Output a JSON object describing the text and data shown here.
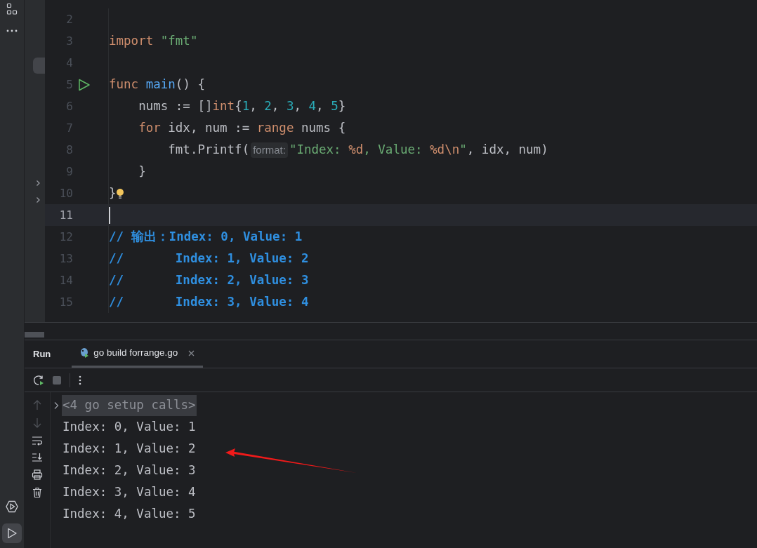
{
  "tool_windows": [
    {
      "kind": "services",
      "selected": false
    },
    {
      "kind": "run",
      "selected": true
    }
  ],
  "editor": {
    "lines": [
      {
        "number": "2",
        "current": false,
        "run_marker": false,
        "bulb": false,
        "caret": false
      },
      {
        "number": "3",
        "current": false,
        "run_marker": false,
        "bulb": false,
        "caret": false,
        "tokens": [
          {
            "text": "import ",
            "kind": "keyword"
          },
          {
            "text": "\"fmt\"",
            "kind": "string"
          }
        ]
      },
      {
        "number": "4",
        "current": false,
        "run_marker": false,
        "bulb": false,
        "caret": false
      },
      {
        "number": "5",
        "current": false,
        "run_marker": true,
        "bulb": false,
        "caret": false,
        "tokens": [
          {
            "text": "func ",
            "kind": "keyword"
          },
          {
            "text": "main",
            "kind": "func"
          },
          {
            "text": "() {",
            "kind": "plain"
          }
        ]
      },
      {
        "number": "6",
        "current": false,
        "run_marker": false,
        "bulb": false,
        "caret": false,
        "tokens": [
          {
            "text": "    nums := []",
            "kind": "plain"
          },
          {
            "text": "int",
            "kind": "keyword"
          },
          {
            "text": "{",
            "kind": "plain"
          },
          {
            "text": "1",
            "kind": "number"
          },
          {
            "text": ", ",
            "kind": "plain"
          },
          {
            "text": "2",
            "kind": "number"
          },
          {
            "text": ", ",
            "kind": "plain"
          },
          {
            "text": "3",
            "kind": "number"
          },
          {
            "text": ", ",
            "kind": "plain"
          },
          {
            "text": "4",
            "kind": "number"
          },
          {
            "text": ", ",
            "kind": "plain"
          },
          {
            "text": "5",
            "kind": "number"
          },
          {
            "text": "}",
            "kind": "plain"
          }
        ]
      },
      {
        "number": "7",
        "current": false,
        "run_marker": false,
        "bulb": false,
        "caret": false,
        "tokens": [
          {
            "text": "    for",
            "kind": "keyword"
          },
          {
            "text": " idx, num := ",
            "kind": "plain"
          },
          {
            "text": "range",
            "kind": "keyword"
          },
          {
            "text": " nums {",
            "kind": "plain"
          }
        ]
      },
      {
        "number": "8",
        "current": false,
        "run_marker": false,
        "bulb": false,
        "caret": false,
        "tokens": [
          {
            "text": "        fmt.Printf(",
            "kind": "plain"
          },
          {
            "text": "format:",
            "kind": "hint"
          },
          {
            "text": "\"Index: ",
            "kind": "string"
          },
          {
            "text": "%d",
            "kind": "escape"
          },
          {
            "text": ", Value: ",
            "kind": "string"
          },
          {
            "text": "%d\\n",
            "kind": "escape"
          },
          {
            "text": "\"",
            "kind": "string"
          },
          {
            "text": ", idx, num)",
            "kind": "plain"
          }
        ]
      },
      {
        "number": "9",
        "current": false,
        "run_marker": false,
        "bulb": false,
        "caret": false,
        "tokens": [
          {
            "text": "    }",
            "kind": "plain"
          }
        ]
      },
      {
        "number": "10",
        "current": false,
        "run_marker": false,
        "bulb": true,
        "caret": false,
        "tokens": [
          {
            "text": "}",
            "kind": "plain"
          }
        ]
      },
      {
        "number": "11",
        "current": true,
        "run_marker": false,
        "bulb": false,
        "caret": true
      },
      {
        "number": "12",
        "current": false,
        "run_marker": false,
        "bulb": false,
        "caret": false,
        "tokens": [
          {
            "text": "// 输出：Index: 0, Value: 1",
            "kind": "comment"
          }
        ]
      },
      {
        "number": "13",
        "current": false,
        "run_marker": false,
        "bulb": false,
        "caret": false,
        "tokens": [
          {
            "text": "//       Index: 1, Value: 2",
            "kind": "comment"
          }
        ]
      },
      {
        "number": "14",
        "current": false,
        "run_marker": false,
        "bulb": false,
        "caret": false,
        "tokens": [
          {
            "text": "//       Index: 2, Value: 3",
            "kind": "comment"
          }
        ]
      },
      {
        "number": "15",
        "current": false,
        "run_marker": false,
        "bulb": false,
        "caret": false,
        "tokens": [
          {
            "text": "//       Index: 3, Value: 4",
            "kind": "comment"
          }
        ]
      }
    ]
  },
  "run_panel": {
    "title": "Run",
    "tabs": [
      {
        "label": "go build forrange.go",
        "selected": true
      }
    ],
    "folded": "<4 go setup calls>",
    "output": [
      "Index: 0, Value: 1",
      "Index: 1, Value: 2",
      "Index: 2, Value: 3",
      "Index: 3, Value: 4",
      "Index: 4, Value: 5"
    ]
  }
}
